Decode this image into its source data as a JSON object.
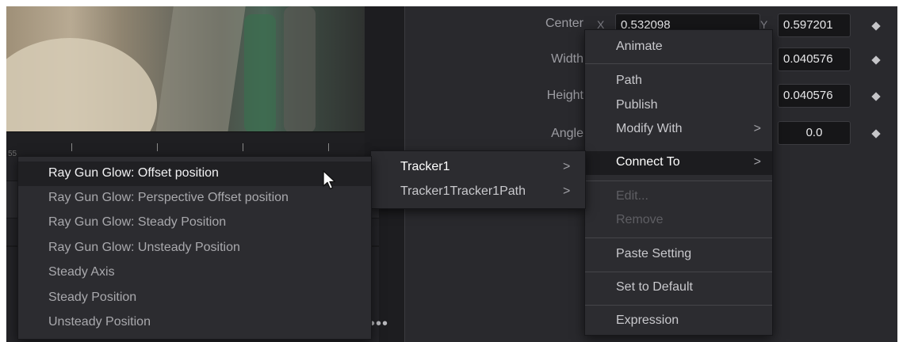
{
  "ruler": {
    "partial_number": "55"
  },
  "inspector": {
    "center": {
      "label": "Center",
      "x_axis": "X",
      "x_value": "0.532098",
      "y_axis": "Y",
      "y_value": "0.597201"
    },
    "width": {
      "label": "Width",
      "value": "0.040576"
    },
    "height": {
      "label": "Height",
      "value": "0.040576"
    },
    "angle": {
      "label": "Angle",
      "value": "0.0"
    }
  },
  "context_menu": {
    "animate": "Animate",
    "path": "Path",
    "publish": "Publish",
    "modify_with": "Modify With",
    "connect_to": "Connect To",
    "edit": "Edit...",
    "remove": "Remove",
    "paste_setting": "Paste Setting",
    "set_to_default": "Set to Default",
    "expression": "Expression",
    "arrow": ">"
  },
  "submenu": {
    "items": [
      "Tracker1",
      "Tracker1Tracker1Path"
    ],
    "arrow": ">"
  },
  "connect_list": {
    "items": [
      "Ray Gun Glow: Offset position",
      "Ray Gun Glow: Perspective Offset position",
      "Ray Gun Glow: Steady Position",
      "Ray Gun Glow: Unsteady Position",
      "Steady Axis",
      "Steady Position",
      "Unsteady Position"
    ]
  },
  "more_button": "•••",
  "colors": {
    "highlight": "#1c1c1f",
    "menu_bg": "#2c2c30",
    "panel_bg": "#26262a"
  }
}
